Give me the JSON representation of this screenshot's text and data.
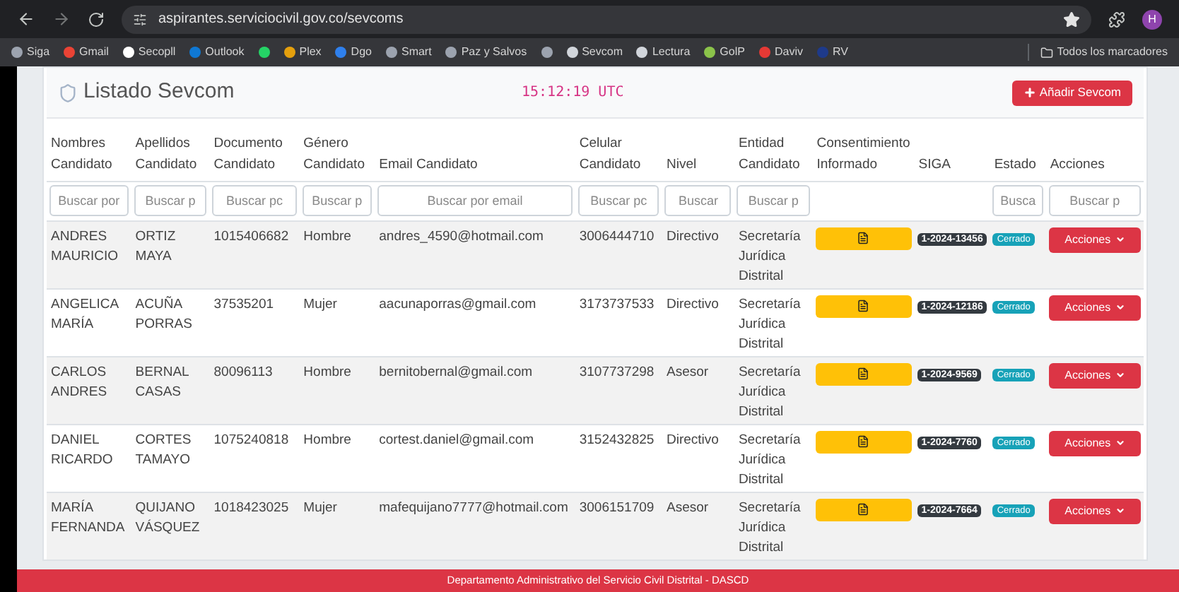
{
  "browser": {
    "url": "aspirantes.serviciocivil.gov.co/sevcoms",
    "profile": "H",
    "bookmarks": [
      {
        "label": "Siga",
        "color": "#9ca3af"
      },
      {
        "label": "Gmail",
        "color": "#ea4335"
      },
      {
        "label": "Secopll",
        "color": "#ffffff"
      },
      {
        "label": "Outlook",
        "color": "#0f78d4"
      },
      {
        "color": "#25d366"
      },
      {
        "label": "Plex",
        "color": "#e5a00d"
      },
      {
        "label": "Dgo",
        "color": "#2f80ed"
      },
      {
        "label": "Smart",
        "color": "#9ca3af"
      },
      {
        "label": "Paz y Salvos",
        "color": "#9ca3af"
      },
      {
        "color": "#9ca3af"
      },
      {
        "label": "Sevcom",
        "color": "#d1d5db"
      },
      {
        "label": "Lectura",
        "color": "#d1d5db"
      },
      {
        "label": "GolP",
        "color": "#8bc34a"
      },
      {
        "label": "Daviv",
        "color": "#e53935"
      },
      {
        "label": "RV",
        "color": "#1e3a8a"
      }
    ],
    "all_bookmarks": "Todos los marcadores"
  },
  "page": {
    "title": "Listado Sevcom",
    "clock": "15:12:19 UTC",
    "add_button": "Añadir Sevcom"
  },
  "table": {
    "columns": [
      {
        "header": "Nombres Candidato",
        "placeholder": "Buscar por"
      },
      {
        "header": "Apellidos Candidato",
        "placeholder": "Buscar p"
      },
      {
        "header": "Documento Candidato",
        "placeholder": "Buscar pc"
      },
      {
        "header": "Género Candidato",
        "placeholder": "Buscar p"
      },
      {
        "header": "Email Candidato",
        "placeholder": "Buscar por email"
      },
      {
        "header": "Celular Candidato",
        "placeholder": "Buscar pc"
      },
      {
        "header": "Nivel",
        "placeholder": "Buscar"
      },
      {
        "header": "Entidad Candidato",
        "placeholder": "Buscar p"
      },
      {
        "header": "Consentimiento Informado"
      },
      {
        "header": "SIGA"
      },
      {
        "header": "Estado",
        "placeholder": "Busca"
      },
      {
        "header": "Acciones",
        "placeholder": "Buscar p"
      }
    ],
    "rows": [
      {
        "cells": [
          "ANDRES MAURICIO",
          "ORTIZ MAYA",
          "1015406682",
          "Hombre",
          "andres_4590@hotmail.com",
          "3006444710",
          "Directivo",
          "Secretaría Jurídica Distrital"
        ],
        "siga": "1-2024-13456",
        "estado": "Cerrado",
        "action": "Acciones"
      },
      {
        "cells": [
          "ANGELICA MARÍA",
          "ACUÑA PORRAS",
          "37535201",
          "Mujer",
          "aacunaporras@gmail.com",
          "3173737533",
          "Directivo",
          "Secretaría Jurídica Distrital"
        ],
        "siga": "1-2024-12186",
        "estado": "Cerrado",
        "action": "Acciones"
      },
      {
        "cells": [
          "CARLOS ANDRES",
          "BERNAL CASAS",
          "80096113",
          "Hombre",
          "bernitobernal@gmail.com",
          "3107737298",
          "Asesor",
          "Secretaría Jurídica Distrital"
        ],
        "siga": "1-2024-9569",
        "estado": "Cerrado",
        "action": "Acciones"
      },
      {
        "cells": [
          "DANIEL RICARDO",
          "CORTES TAMAYO",
          "1075240818",
          "Hombre",
          "cortest.daniel@gmail.com",
          "3152432825",
          "Directivo",
          "Secretaría Jurídica Distrital"
        ],
        "siga": "1-2024-7760",
        "estado": "Cerrado",
        "action": "Acciones"
      },
      {
        "cells": [
          "MARÍA FERNANDA",
          "QUIJANO VÁSQUEZ",
          "1018423025",
          "Mujer",
          "mafequijano7777@hotmail.com",
          "3006151709",
          "Asesor",
          "Secretaría Jurídica Distrital"
        ],
        "siga": "1-2024-7664",
        "estado": "Cerrado",
        "action": "Acciones"
      }
    ]
  },
  "footer": "Departamento Administrativo del Servicio Civil Distrital - DASCD"
}
